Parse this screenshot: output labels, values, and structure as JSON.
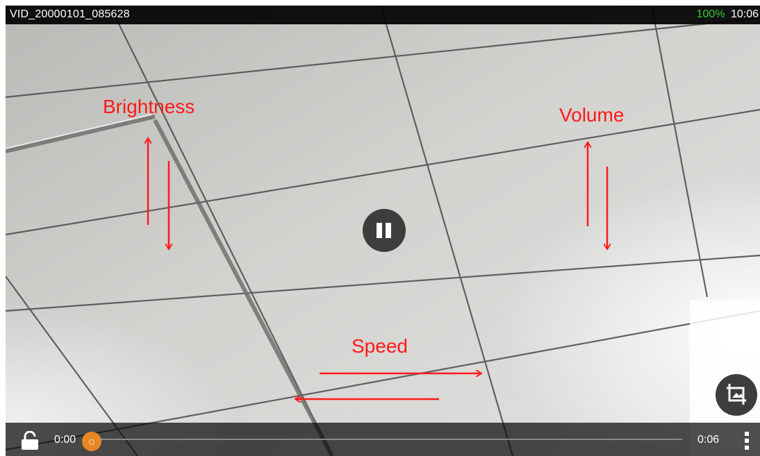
{
  "top_bar": {
    "video_title": "VID_20000101_085628",
    "battery": "100%",
    "clock": "10:06",
    "battery_color": "#33cc33"
  },
  "playback": {
    "state_icon": "pause-icon",
    "current_time": "0:00",
    "total_time": "0:06",
    "progress": 0.0,
    "accent_color": "#f08a24"
  },
  "icons": {
    "lock": "lock-open-icon",
    "crop": "crop-icon",
    "more": "more-vertical-icon"
  },
  "annotations": {
    "brightness": "Brightness",
    "volume": "Volume",
    "speed": "Speed",
    "color": "#ff1a1a"
  }
}
